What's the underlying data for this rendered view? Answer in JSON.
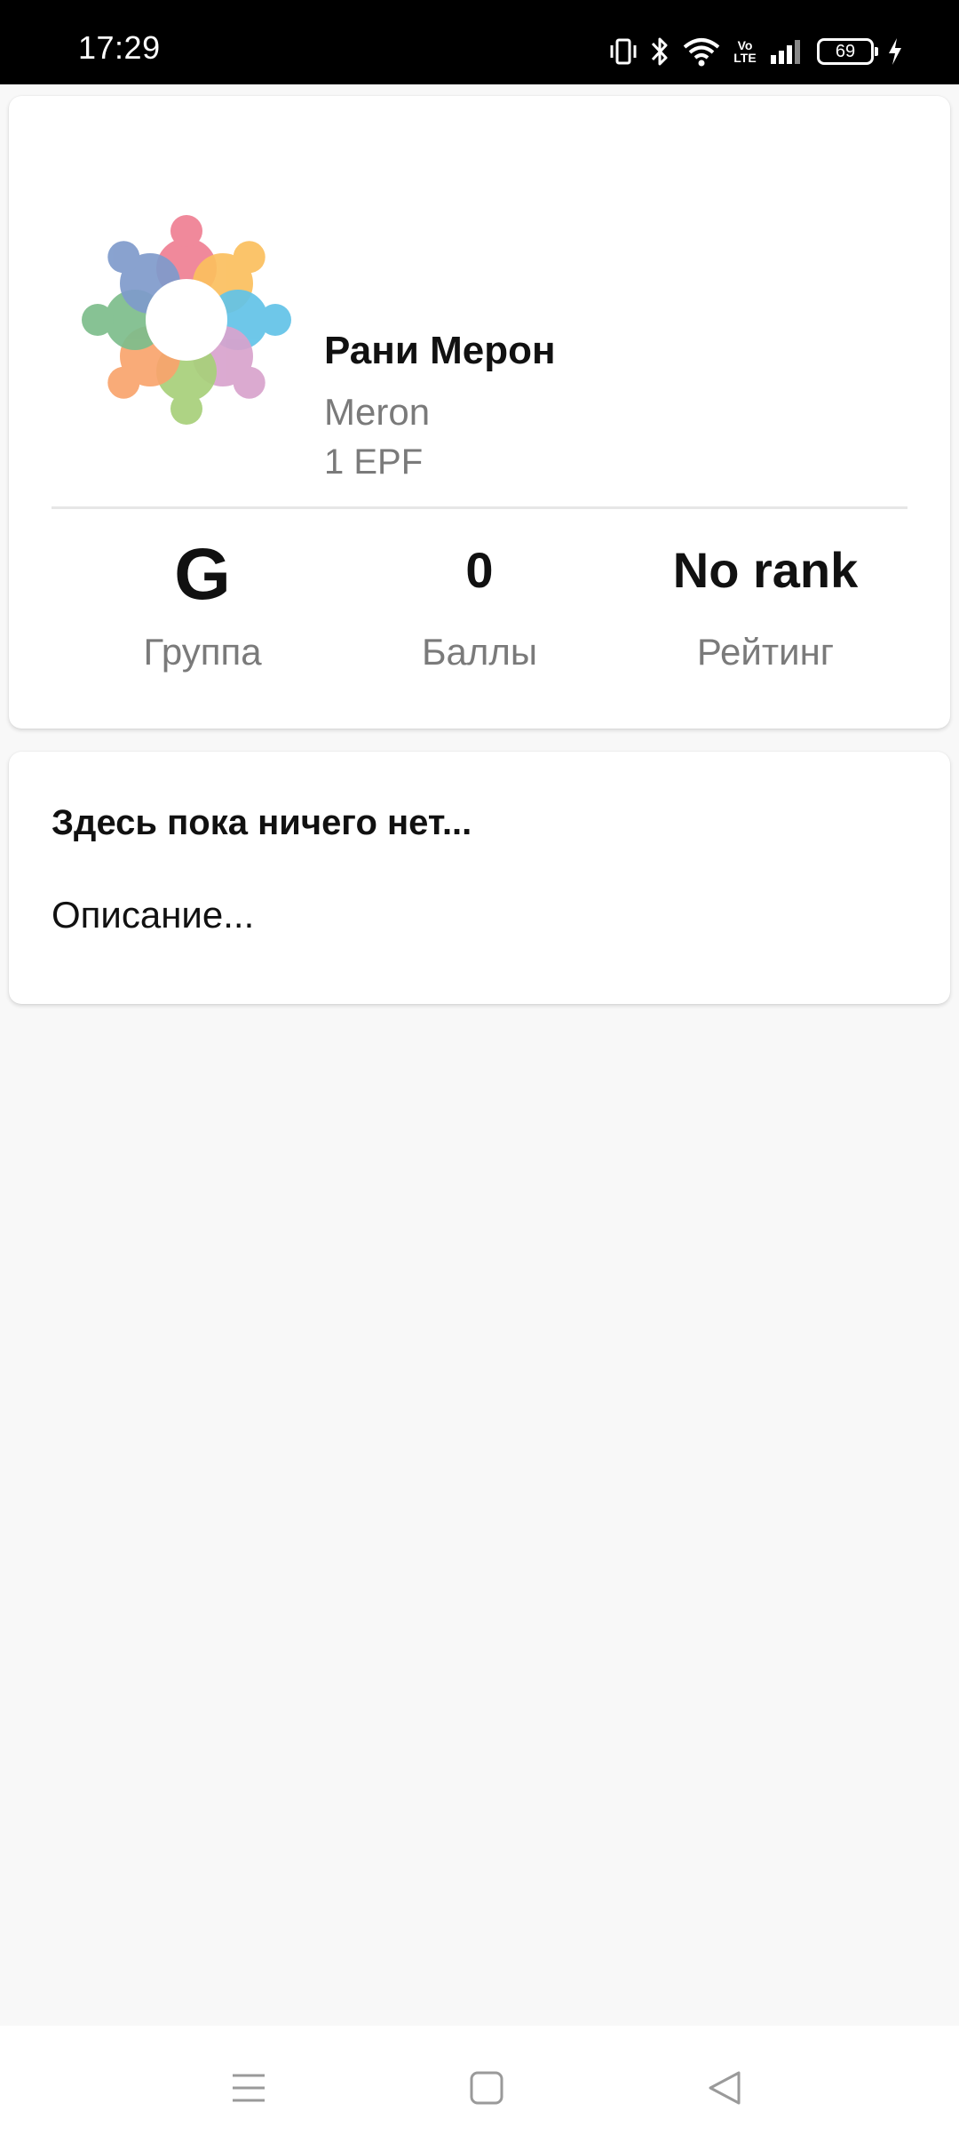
{
  "status_bar": {
    "time": "17:29",
    "volte_label": "Vo\nLTE",
    "battery": "69",
    "icons": [
      "vibrate-icon",
      "bluetooth-icon",
      "wifi-icon",
      "volte-icon",
      "signal-icon",
      "battery-icon",
      "charging-icon"
    ]
  },
  "profile": {
    "name": "Рани Мерон",
    "username": "Meron",
    "class": "1 EPF",
    "avatar_icon": "community-people-circle-icon",
    "avatar_colors": [
      "#ef7f93",
      "#fbbf5e",
      "#62c3e8",
      "#d8a3cd",
      "#a8d07a",
      "#f9a46d",
      "#7dbd8c",
      "#7f9bcc"
    ]
  },
  "stats": [
    {
      "value": "G",
      "label": "Группа"
    },
    {
      "value": "0",
      "label": "Баллы"
    },
    {
      "value": "No rank",
      "label": "Рейтинг"
    }
  ],
  "info": {
    "title": "Здесь пока ничего нет...",
    "description": "Описание..."
  },
  "nav_bar": {
    "icons": [
      "menu-icon",
      "home-icon",
      "back-icon"
    ]
  }
}
